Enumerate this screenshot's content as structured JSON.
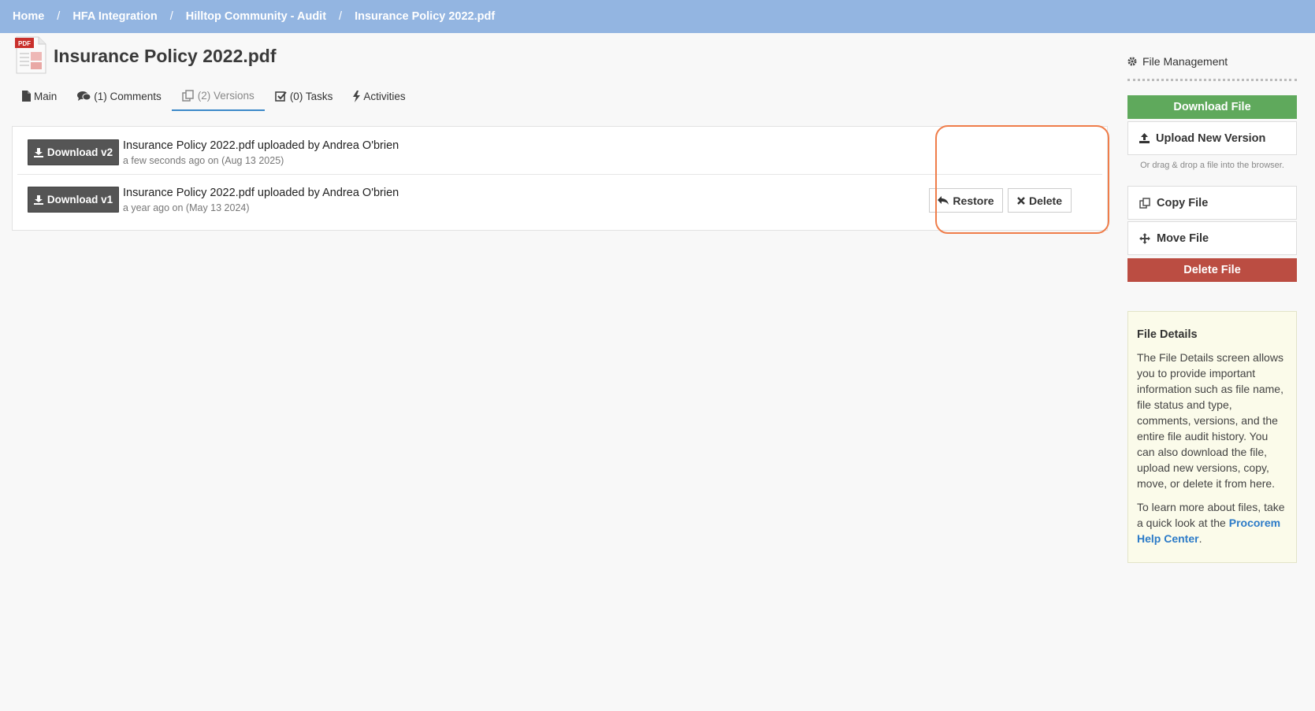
{
  "breadcrumb": [
    {
      "label": "Home"
    },
    {
      "label": "HFA Integration"
    },
    {
      "label": "Hilltop Community - Audit"
    },
    {
      "label": "Insurance Policy 2022.pdf"
    }
  ],
  "breadcrumb_separator": "/",
  "file": {
    "icon_label": "PDF",
    "title": "Insurance Policy 2022.pdf"
  },
  "tabs": [
    {
      "label": "Main",
      "icon": "file-icon"
    },
    {
      "label": "(1) Comments",
      "icon": "comments-icon"
    },
    {
      "label": "(2) Versions",
      "icon": "versions-icon",
      "active": true
    },
    {
      "label": "(0) Tasks",
      "icon": "checkbox-icon"
    },
    {
      "label": "Activities",
      "icon": "bolt-icon"
    }
  ],
  "versions": [
    {
      "download_label": "Download v2",
      "title": "Insurance Policy 2022.pdf uploaded by Andrea O'brien",
      "subtitle": "a few seconds ago on (Aug 13 2025)"
    },
    {
      "download_label": "Download v1",
      "title": "Insurance Policy 2022.pdf uploaded by Andrea O'brien",
      "subtitle": "a year ago on (May 13 2024)",
      "restore_label": "Restore",
      "delete_label": "Delete"
    }
  ],
  "sidebar": {
    "heading": "File Management",
    "download_file": "Download File",
    "upload_new_version": "Upload New Version",
    "drag_hint": "Or drag & drop a file into the browser.",
    "copy_file": "Copy File",
    "move_file": "Move File",
    "delete_file": "Delete File"
  },
  "details": {
    "title": "File Details",
    "body": "The File Details screen allows you to provide important information such as file name, file status and type, comments, versions, and the entire file audit history. You can also download the file, upload new versions, copy, move, or delete it from here.",
    "learn_more_prefix": "To learn more about files, take a quick look at the",
    "help_link": "Procorem Help Center",
    "learn_more_suffix": "."
  },
  "colors": {
    "breadcrumb_bg": "#93b5e1",
    "download_green": "#5fa95c",
    "delete_red": "#bb4d42",
    "highlight_orange": "#ef7d4a",
    "active_tab_underline": "#3b89c9",
    "link_blue": "#2c7bc8"
  }
}
